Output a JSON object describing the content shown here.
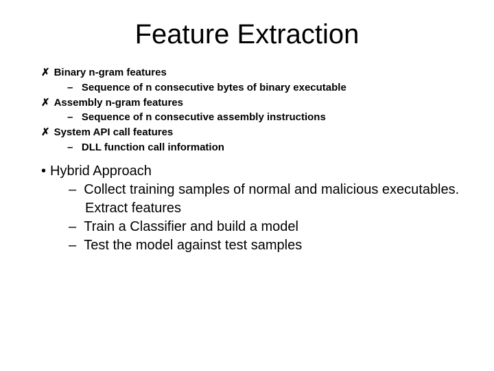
{
  "title": "Feature Extraction",
  "small": {
    "item1": {
      "label": "Binary n-gram features",
      "sub": "Sequence of n consecutive bytes of binary executable"
    },
    "item2": {
      "label": "Assembly n-gram features",
      "sub": "Sequence of n consecutive assembly instructions"
    },
    "item3": {
      "label": "System API call features",
      "sub": "DLL function call information"
    }
  },
  "large": {
    "top": "Hybrid Approach",
    "sub1a": "Collect training samples of normal and malicious executables.",
    "sub1b": "Extract features",
    "sub2": "Train a Classifier and build a model",
    "sub3": "Test the model against test samples"
  },
  "glyph": {
    "cross": "✗",
    "dash": "–",
    "dot": "•"
  }
}
